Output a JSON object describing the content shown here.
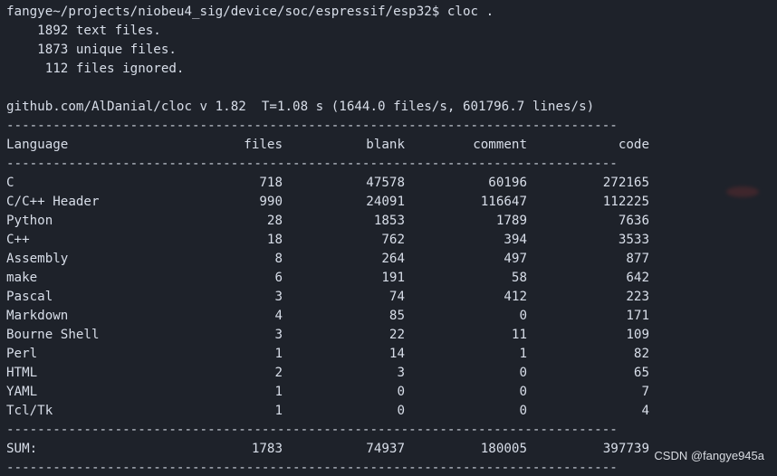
{
  "prompt": {
    "text": "fangye~/projects/niobeu4_sig/device/soc/espressif/esp32$ cloc ."
  },
  "summary_lines": [
    "    1892 text files.",
    "    1873 unique files.",
    "     112 files ignored."
  ],
  "version_line": "github.com/AlDanial/cloc v 1.82  T=1.08 s (1644.0 files/s, 601796.7 lines/s)",
  "separator": "-------------------------------------------------------------------------------",
  "table": {
    "headers": [
      "Language",
      "files",
      "blank",
      "comment",
      "code"
    ],
    "rows": [
      [
        "C",
        "718",
        "47578",
        "60196",
        "272165"
      ],
      [
        "C/C++ Header",
        "990",
        "24091",
        "116647",
        "112225"
      ],
      [
        "Python",
        "28",
        "1853",
        "1789",
        "7636"
      ],
      [
        "C++",
        "18",
        "762",
        "394",
        "3533"
      ],
      [
        "Assembly",
        "8",
        "264",
        "497",
        "877"
      ],
      [
        "make",
        "6",
        "191",
        "58",
        "642"
      ],
      [
        "Pascal",
        "3",
        "74",
        "412",
        "223"
      ],
      [
        "Markdown",
        "4",
        "85",
        "0",
        "171"
      ],
      [
        "Bourne Shell",
        "3",
        "22",
        "11",
        "109"
      ],
      [
        "Perl",
        "1",
        "14",
        "1",
        "82"
      ],
      [
        "HTML",
        "2",
        "3",
        "0",
        "65"
      ],
      [
        "YAML",
        "1",
        "0",
        "0",
        "7"
      ],
      [
        "Tcl/Tk",
        "1",
        "0",
        "0",
        "4"
      ]
    ],
    "sum": [
      "SUM:",
      "1783",
      "74937",
      "180005",
      "397739"
    ]
  },
  "watermark": "CSDN @fangye945a",
  "colors": {
    "background": "#1e222a",
    "text": "#d8dee9"
  }
}
